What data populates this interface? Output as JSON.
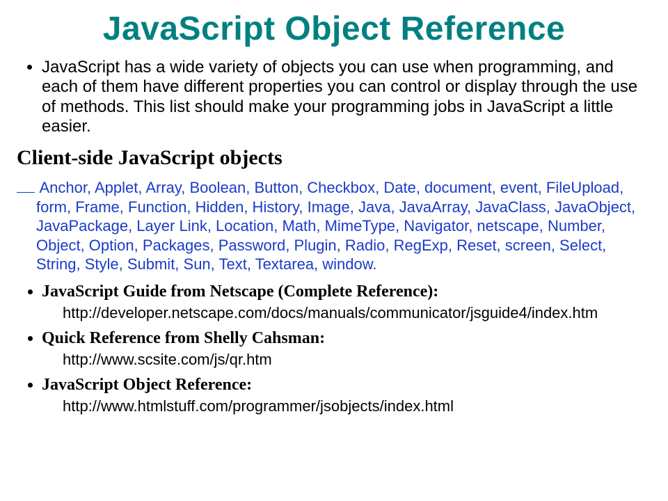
{
  "title": "JavaScript Object Reference",
  "intro": "JavaScript has a wide variety of objects you can use when programming, and each of them have different properties you can control or display through the use of methods. This list should make your programming jobs in JavaScript a little easier.",
  "subhead": "Client-side JavaScript objects",
  "objects_list": "Anchor, Applet, Array, Boolean, Button, Checkbox, Date, document, event, FileUpload, form, Frame, Function, Hidden, History, Image, Java, JavaArray, JavaClass, JavaObject, JavaPackage, Layer Link, Location, Math, MimeType, Navigator, netscape, Number, Object, Option, Packages, Password, Plugin, Radio, RegExp, Reset, screen, Select, String, Style, Submit, Sun, Text, Textarea, window.",
  "refs": [
    {
      "label": "JavaScript Guide from Netscape (Complete Reference):",
      "url": "http://developer.netscape.com/docs/manuals/communicator/jsguide4/index.htm"
    },
    {
      "label": "Quick Reference from Shelly Cahsman:",
      "url": "http://www.scsite.com/js/qr.htm"
    },
    {
      "label": "JavaScript Object Reference:",
      "url": "http://www.htmlstuff.com/programmer/jsobjects/index.html"
    }
  ]
}
